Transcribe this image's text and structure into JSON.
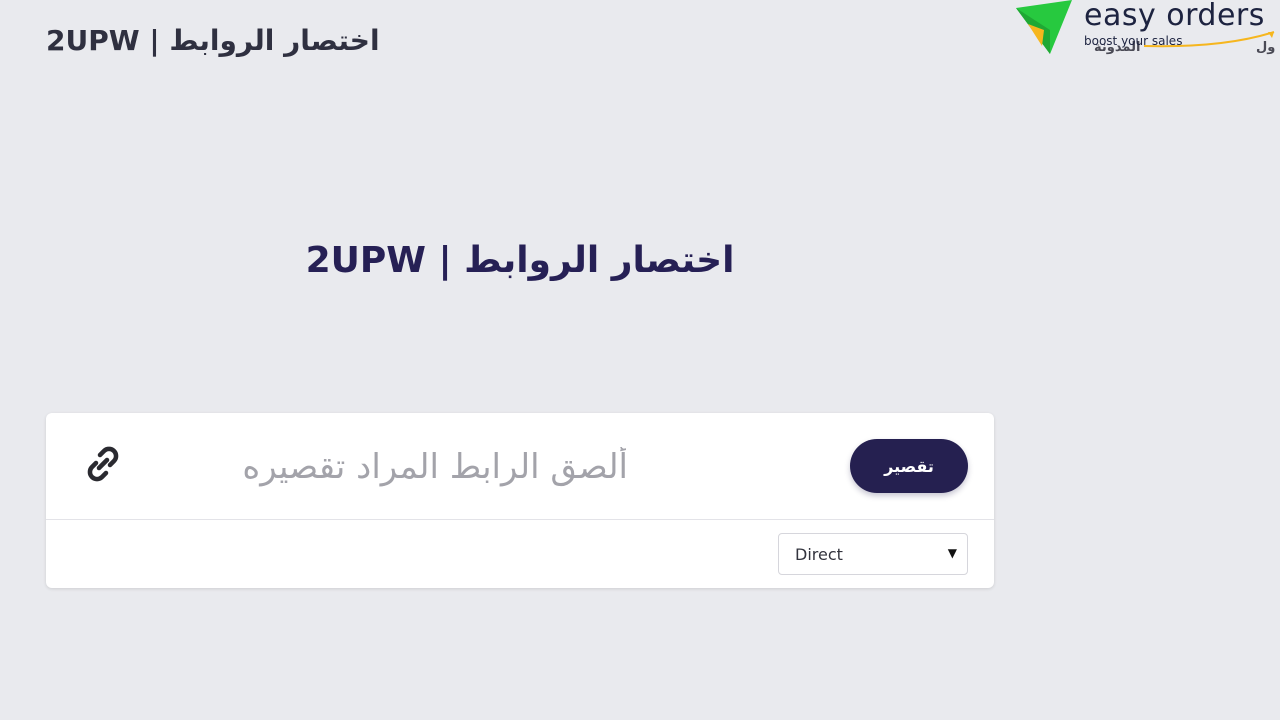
{
  "header": {
    "title": "2UPW | اختصار الروابط",
    "nav_partial_1": "المدونة",
    "nav_partial_2": "ول"
  },
  "logo": {
    "name": "easy orders",
    "tagline": "boost your sales",
    "icon": "paper-plane-icon",
    "colors": {
      "green": "#27c93f",
      "yellow": "#f6b61e",
      "text": "#1d2340"
    }
  },
  "hero": {
    "title": "2UPW | اختصار الروابط"
  },
  "shortener": {
    "input_placeholder": "ألصق الرابط المراد تقصيره",
    "input_value": "",
    "link_icon": "link-icon",
    "button_label": "تقصير",
    "redirect_type": {
      "selected": "Direct"
    }
  },
  "colors": {
    "background": "#e9eaee",
    "accent": "#252050",
    "card": "#ffffff"
  }
}
